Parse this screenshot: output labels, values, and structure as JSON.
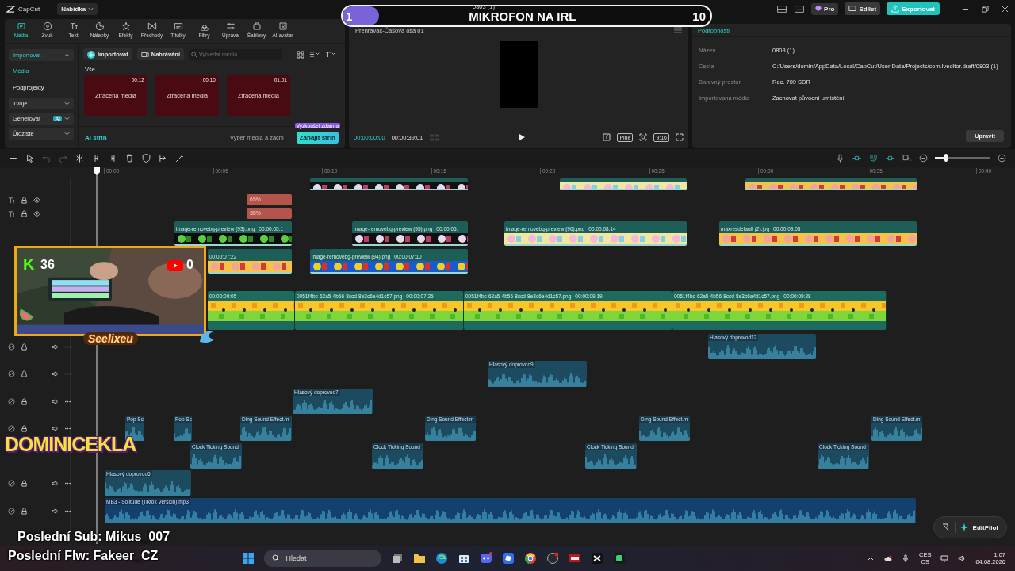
{
  "app": {
    "logo": "CapCut",
    "menu": "Nabídka",
    "project_title": "0803 (1)",
    "pro": "Pro",
    "share": "Sdílet",
    "export": "Exportovat"
  },
  "goal_bar": {
    "current": "1",
    "title": "MIKROFON NA IRL",
    "target": "10",
    "level": 0.1
  },
  "toolbar_tabs": [
    {
      "label": "Média",
      "selected": true
    },
    {
      "label": "Zvuk",
      "selected": false
    },
    {
      "label": "Text",
      "selected": false
    },
    {
      "label": "Nálepky",
      "selected": false
    },
    {
      "label": "Efekty",
      "selected": false
    },
    {
      "label": "Přechody",
      "selected": false
    },
    {
      "label": "Titulky",
      "selected": false
    },
    {
      "label": "Filtry",
      "selected": false
    },
    {
      "label": "Úprava",
      "selected": false
    },
    {
      "label": "Šablony",
      "selected": false
    },
    {
      "label": "AI avatar",
      "selected": false
    }
  ],
  "media_sidebar": [
    {
      "kind": "group",
      "label": "Importovat",
      "expanded": true
    },
    {
      "kind": "item",
      "label": "Média",
      "selected": true
    },
    {
      "kind": "item",
      "label": "Podprojekty",
      "selected": false
    },
    {
      "kind": "group",
      "label": "Tvoje",
      "expanded": false
    },
    {
      "kind": "group",
      "label": "Generovat",
      "expanded": false,
      "badge": "AI"
    },
    {
      "kind": "group",
      "label": "Úložiště",
      "expanded": false
    }
  ],
  "media_toolbar": {
    "import": "Importovat",
    "record": "Nahrávání",
    "search_placeholder": "Vyhledat média"
  },
  "media": {
    "section": "Vše",
    "items": [
      {
        "status": "Ztracená média",
        "duration": "00:12"
      },
      {
        "status": "Ztracená média",
        "duration": "00:10"
      },
      {
        "status": "Ztracená média",
        "duration": "01:01"
      }
    ]
  },
  "ai_cut": {
    "label": "AI střih",
    "hint": "Vyber média a začni",
    "button": "Zahájit střih",
    "badge": "Vyzkoušet zdarma"
  },
  "player": {
    "title": "Přehrávač-Časová osa 01",
    "current_time": "00:00:00:00",
    "total_time": "00:00:39:01",
    "fit": "Plné",
    "ratio": "9:16"
  },
  "details": {
    "title": "Podrobnosti",
    "rows": [
      {
        "label": "Název",
        "value": "0803 (1)"
      },
      {
        "label": "Cesta",
        "value": "C:/Users/domin/AppData/Local/CapCut/User Data/Projects/com.lveditor.draft/0803 (1)"
      },
      {
        "label": "Barevný prostor",
        "value": "Rec. 709 SDR"
      },
      {
        "label": "Importovaná média",
        "value": "Zachovat původní umístění"
      }
    ],
    "button": "Upravit"
  },
  "timeline_toolbar": {
    "zoom": {
      "level": 0.2
    }
  },
  "ruler": [
    "00:00",
    "00:05",
    "00:10",
    "00:15",
    "00:20",
    "00:25",
    "00:30",
    "00:35",
    "00:40"
  ],
  "tracks": [
    {
      "kind": "video",
      "clips": [
        {
          "kind": "video"
        },
        {
          "kind": "video"
        },
        {
          "kind": "video"
        }
      ]
    },
    {
      "kind": "text",
      "clips": [
        {
          "kind": "percent",
          "label": "65%"
        }
      ]
    },
    {
      "kind": "text",
      "clips": [
        {
          "kind": "percent",
          "label": "35%"
        }
      ]
    },
    {
      "kind": "video",
      "clips": [
        {
          "kind": "video",
          "label": "image-removebg-preview (93).png",
          "duration": "00:00:05:1"
        },
        {
          "kind": "video",
          "label": "image-removebg-preview (95).png",
          "duration": "00:00:05:"
        },
        {
          "kind": "video",
          "label": "image-removebg-preview (96).png",
          "duration": "00:00:08:14"
        },
        {
          "kind": "video",
          "label": "maxresdefault (2).jpg",
          "duration": "00:00:09:05"
        }
      ]
    },
    {
      "kind": "video",
      "clips": [
        {
          "kind": "video",
          "duration": "00:00:07:22"
        },
        {
          "kind": "video",
          "label": "image-removebg-preview (94).png",
          "duration": "00:00:07:10"
        }
      ]
    },
    {
      "kind": "main",
      "clips": [
        {
          "kind": "main",
          "duration": "00:00:09:05"
        },
        {
          "kind": "main",
          "label": "0051f4bc-62a5-4b56-8ccd-8e3c6a4d1c57.png",
          "duration": "00:00:07:25"
        },
        {
          "kind": "main",
          "label": "0051f4bc-62a5-4b56-8ccd-8e3c6a4d1c57.png",
          "duration": "00:00:09:19"
        },
        {
          "kind": "main",
          "label": "0051f4bc-62a5-4b56-8ccd-8e3c6a4d1c57.png",
          "duration": "00:00:09:28"
        }
      ]
    },
    {
      "kind": "audio",
      "clips": [
        {
          "kind": "audio",
          "label": "Hlasový doprovod12"
        }
      ]
    },
    {
      "kind": "audio",
      "clips": [
        {
          "kind": "audio",
          "label": "Hlasový doprovod9"
        }
      ]
    },
    {
      "kind": "audio",
      "clips": [
        {
          "kind": "audio",
          "label": "Hlasový doprovod7"
        }
      ]
    },
    {
      "kind": "audio",
      "clips": [
        {
          "kind": "audio",
          "label": "Pop Sc"
        },
        {
          "kind": "audio",
          "label": "Pop Sc"
        },
        {
          "kind": "audio",
          "label": "Ding Sound Effect.m"
        },
        {
          "kind": "audio",
          "label": "Ding Sound Effect.m"
        },
        {
          "kind": "audio",
          "label": "Ding Sound Effect.m"
        },
        {
          "kind": "audio",
          "label": "Ding Sound Effect.m"
        }
      ]
    },
    {
      "kind": "audio",
      "clips": [
        {
          "kind": "audio",
          "label": "Clock Ticking Sound"
        },
        {
          "kind": "audio",
          "label": "Clock Ticking Sound"
        },
        {
          "kind": "audio",
          "label": "Clock Ticking Sound"
        },
        {
          "kind": "audio",
          "label": "Clock Ticking Sound"
        }
      ]
    },
    {
      "kind": "audio",
      "clips": [
        {
          "kind": "audio",
          "label": "Hlasový doprovod6"
        }
      ]
    },
    {
      "kind": "audio",
      "clips": [
        {
          "kind": "audio",
          "label": "MB3 - Solitude (Tiktok Version).mp3"
        }
      ]
    }
  ],
  "edit_pilot": "EditPilot",
  "overlay": {
    "kick_label": "K",
    "kick_count": "36",
    "youtube_count": "0",
    "streamer": "Seelixeu",
    "logo": "DOMINICEKLA",
    "last_sub": "Poslední Sub: Mikus_007",
    "last_follow": "Poslední Flw: Fakeer_CZ"
  },
  "taskbar": {
    "search_placeholder": "Hledat",
    "lang_top": "CES",
    "lang_bottom": "CS",
    "time": "1:07",
    "date": "04.08.2026"
  }
}
